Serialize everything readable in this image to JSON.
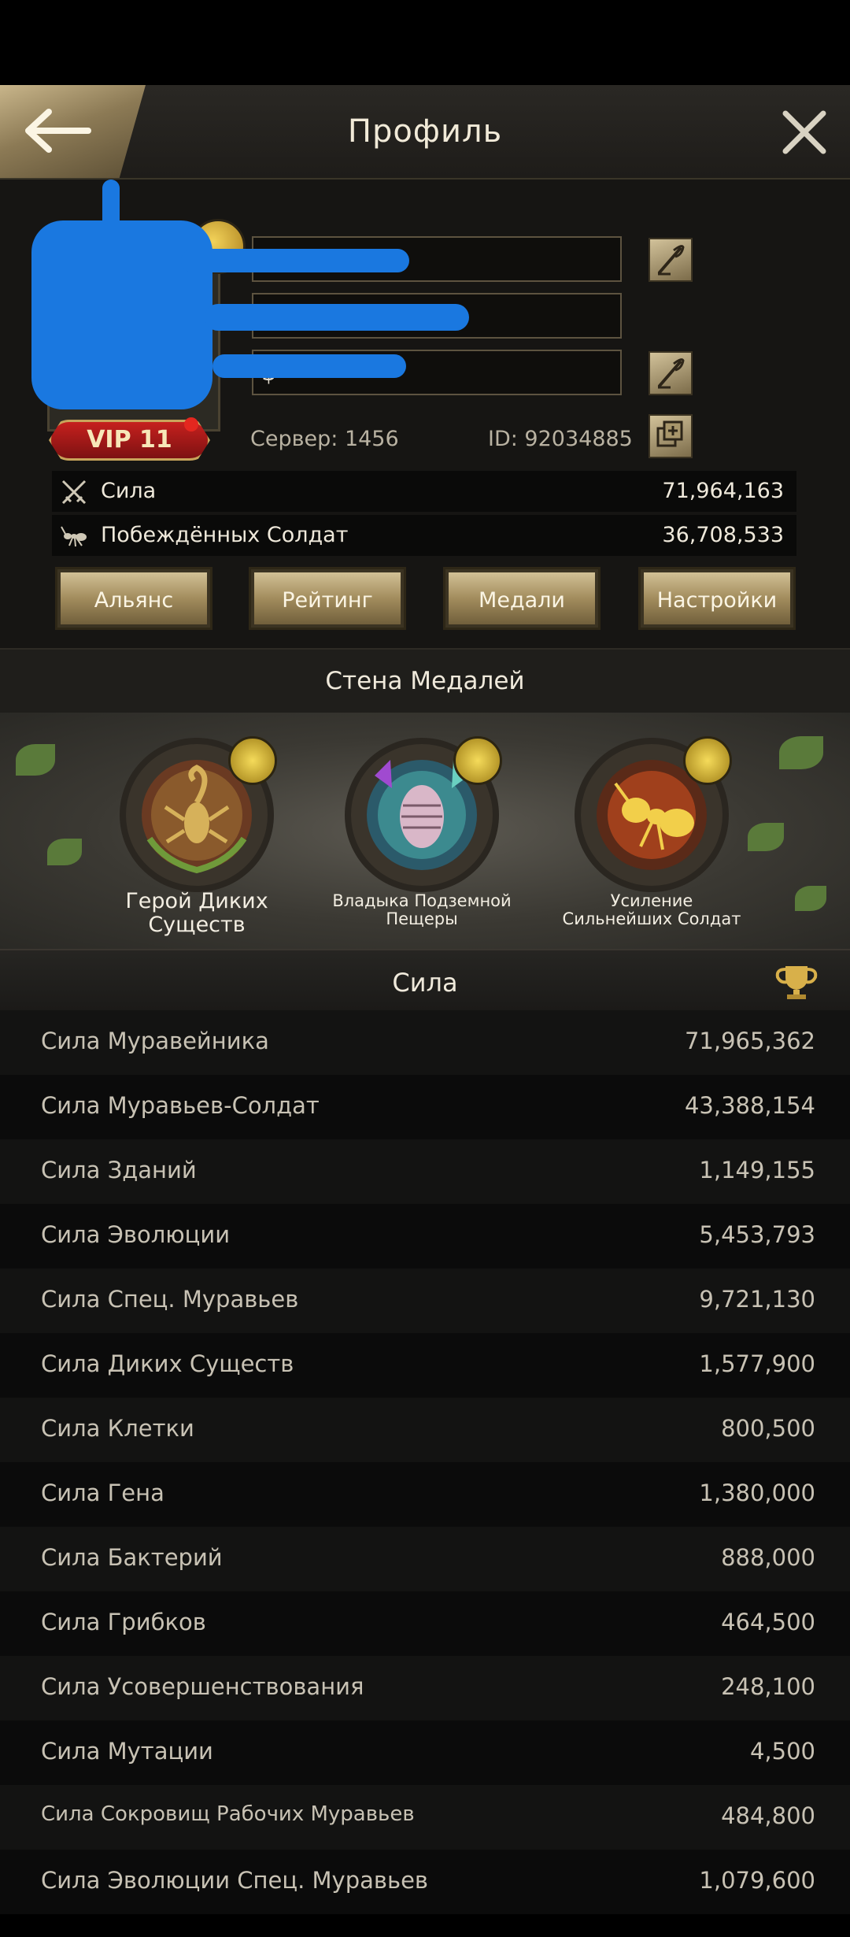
{
  "header": {
    "title": "Профиль"
  },
  "profile": {
    "name_field": "",
    "alliance_field": "[",
    "motto_field": "$",
    "vip_label": "VIP 11",
    "server_text": "Сервер: 1456",
    "id_text": "ID: 92034885"
  },
  "stats": [
    {
      "label": "Сила",
      "value": "71,964,163",
      "icon": "crossed-swords-icon"
    },
    {
      "label": "Побеждённых Солдат",
      "value": "36,708,533",
      "icon": "ant-icon"
    }
  ],
  "tabs": [
    "Альянс",
    "Рейтинг",
    "Медали",
    "Настройки"
  ],
  "medal_wall": {
    "title": "Стена Медалей",
    "medals": [
      {
        "name": "Герой Диких Существ",
        "icon": "scorpion-medal-icon"
      },
      {
        "name": "Владыка Подземной Пещеры",
        "icon": "trilobite-medal-icon"
      },
      {
        "name": "Усиление Сильнейших Солдат",
        "icon": "golden-ant-medal-icon"
      }
    ]
  },
  "power": {
    "title": "Сила",
    "rows": [
      {
        "label": "Сила Муравейника",
        "value": "71,965,362"
      },
      {
        "label": "Сила Муравьев-Солдат",
        "value": "43,388,154"
      },
      {
        "label": "Сила Зданий",
        "value": "1,149,155"
      },
      {
        "label": "Сила Эволюции",
        "value": "5,453,793"
      },
      {
        "label": "Сила Спец. Муравьев",
        "value": "9,721,130"
      },
      {
        "label": "Сила Диких Существ",
        "value": "1,577,900"
      },
      {
        "label": "Сила Клетки",
        "value": "800,500"
      },
      {
        "label": "Сила Гена",
        "value": "1,380,000"
      },
      {
        "label": "Сила Бактерий",
        "value": "888,000"
      },
      {
        "label": "Сила Грибков",
        "value": "464,500"
      },
      {
        "label": "Сила Усовершенствования",
        "value": "248,100"
      },
      {
        "label": "Сила Мутации",
        "value": "4,500"
      },
      {
        "label": "Сила Сокровищ Рабочих Муравьев",
        "value": "484,800"
      },
      {
        "label": "Сила Эволюции Спец. Муравьев",
        "value": "1,079,600"
      }
    ]
  }
}
